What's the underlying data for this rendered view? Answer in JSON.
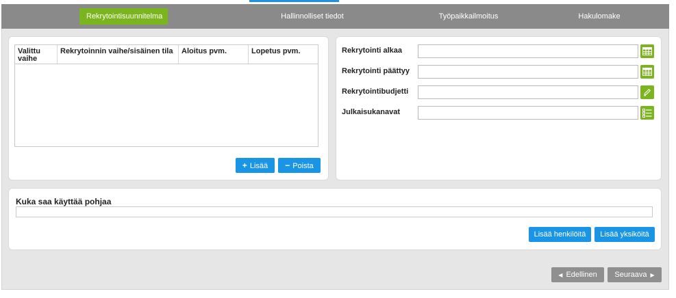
{
  "tabs": [
    {
      "label": "Rekrytointisuunnitelma",
      "active": true
    },
    {
      "label": "Hallinnolliset tiedot",
      "active": false
    },
    {
      "label": "Työpaikkailmoitus",
      "active": false
    },
    {
      "label": "Hakulomake",
      "active": false
    }
  ],
  "phases": {
    "columns": [
      "Valittu vaihe",
      "Rekrytoinnin vaihe/sisäinen tila",
      "Aloitus pvm.",
      "Lopetus pvm."
    ],
    "rows": [],
    "add_label": "Lisää",
    "remove_label": "Poista"
  },
  "details": {
    "start_label": "Rekrytointi alkaa",
    "start_value": "",
    "end_label": "Rekrytointi päättyy",
    "end_value": "",
    "budget_label": "Rekrytointibudjetti",
    "budget_value": "",
    "channels_label": "Julkaisukanavat",
    "channels_value": ""
  },
  "access": {
    "title": "Kuka saa käyttää pohjaa",
    "value": "",
    "add_people_label": "Lisää henkilöitä",
    "add_units_label": "Lisää yksiköitä"
  },
  "nav": {
    "prev_label": "Edellinen",
    "next_label": "Seuraava"
  },
  "colors": {
    "accent_green": "#7ab51d",
    "accent_blue": "#1a95e6",
    "tabbar_gray": "#8a8a8a",
    "nav_gray": "#8f8f8f"
  }
}
